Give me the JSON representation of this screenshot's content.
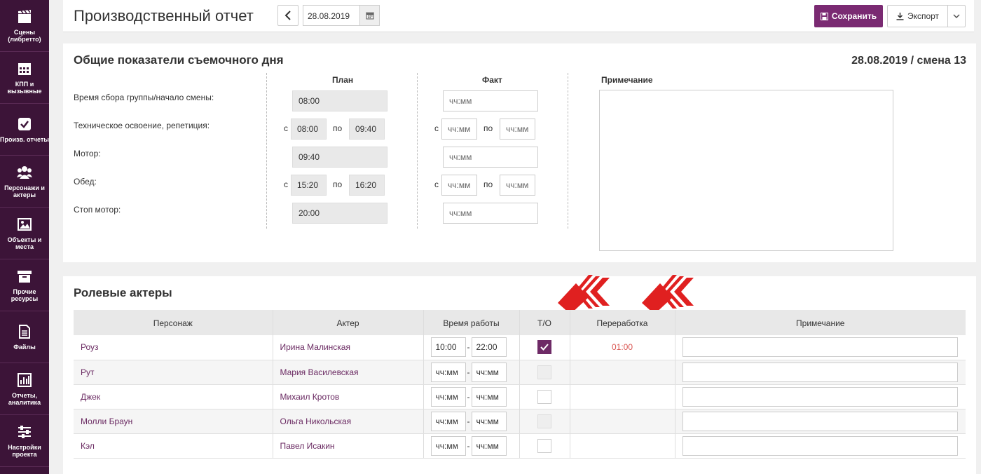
{
  "sidebar": {
    "items": [
      {
        "label": "Сцены (либретто)",
        "icon": "clapperboard-icon"
      },
      {
        "label": "КПП и вызывные",
        "icon": "calendar-icon"
      },
      {
        "label": "Произв. отчеты",
        "icon": "checkbox-icon"
      },
      {
        "label": "Персонажи и актеры",
        "icon": "people-icon"
      },
      {
        "label": "Объекты и места",
        "icon": "image-icon"
      },
      {
        "label": "Прочие ресурсы",
        "icon": "archive-icon"
      },
      {
        "label": "Файлы",
        "icon": "file-icon"
      },
      {
        "label": "Отчеты, аналитика",
        "icon": "chart-icon"
      },
      {
        "label": "Настройки проекта",
        "icon": "sliders-icon"
      }
    ]
  },
  "header": {
    "title": "Производственный отчет",
    "date": "28.08.2019",
    "save_label": "Сохранить",
    "export_label": "Экспорт"
  },
  "day_panel": {
    "title": "Общие показатели съемочного дня",
    "shift": "28.08.2019 / смена 13",
    "plan_header": "План",
    "fact_header": "Факт",
    "note_header": "Примечание",
    "from_label": "с",
    "to_label": "по",
    "placeholder": "чч:мм",
    "rows": {
      "gather": {
        "label": "Время сбора группы/начало смены:",
        "plan": "08:00"
      },
      "tech": {
        "label": "Техническое освоение, репетиция:",
        "plan_from": "08:00",
        "plan_to": "09:40"
      },
      "motor": {
        "label": "Мотор:",
        "plan": "09:40"
      },
      "lunch": {
        "label": "Обед:",
        "plan_from": "15:20",
        "plan_to": "16:20"
      },
      "stop": {
        "label": "Стоп мотор:",
        "plan": "20:00"
      }
    }
  },
  "actors_panel": {
    "title": "Ролевые актеры",
    "columns": [
      "Персонаж",
      "Актер",
      "Время работы",
      "Т/О",
      "Переработка",
      "Примечание"
    ],
    "rows": [
      {
        "character": "Роуз",
        "actor": "Ирина Малинская",
        "from": "10:00",
        "to": "22:00",
        "to_state": "checked",
        "overtime": "01:00"
      },
      {
        "character": "Рут",
        "actor": "Мария Василевская",
        "from": "чч:мм",
        "to": "чч:мм",
        "to_state": "disabled",
        "overtime": ""
      },
      {
        "character": "Джек",
        "actor": "Михаил Кротов",
        "from": "чч:мм",
        "to": "чч:мм",
        "to_state": "empty",
        "overtime": ""
      },
      {
        "character": "Молли Браун",
        "actor": "Ольга Никольская",
        "from": "чч:мм",
        "to": "чч:мм",
        "to_state": "disabled",
        "overtime": ""
      },
      {
        "character": "Кэл",
        "actor": "Павел Исакин",
        "from": "чч:мм",
        "to": "чч:мм",
        "to_state": "empty",
        "overtime": ""
      }
    ],
    "dash": "-"
  },
  "colors": {
    "sidebar": "#3c1438",
    "accent": "#7a2a72",
    "overtime": "#d9534f",
    "arrows": "#e02020"
  }
}
